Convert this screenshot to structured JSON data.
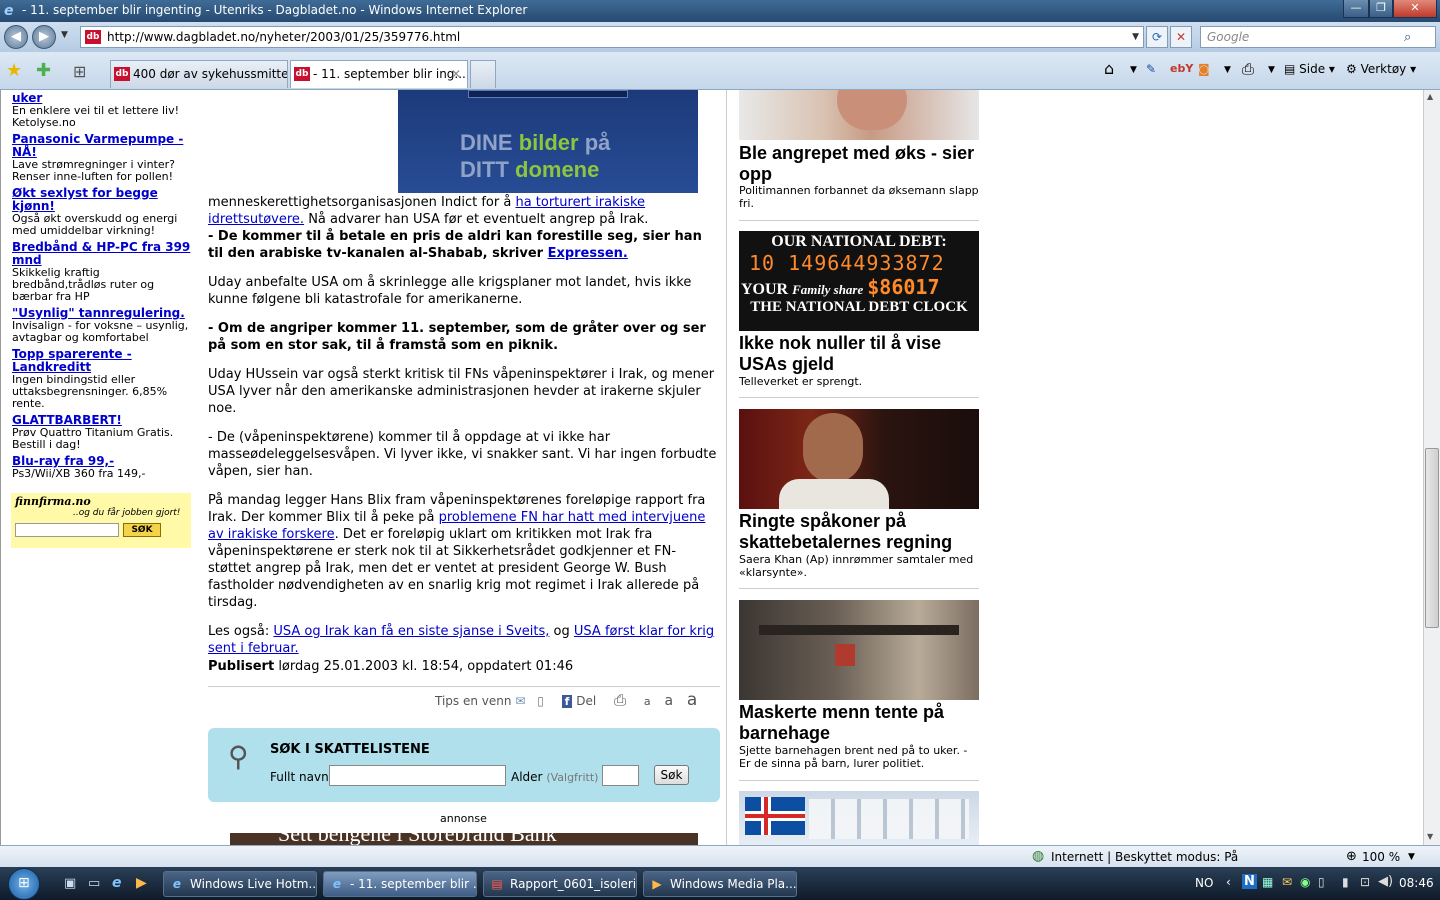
{
  "window": {
    "title": "- 11. september blir ingenting - Utenriks - Dagbladet.no - Windows Internet Explorer",
    "minimize": "—",
    "maximize": "❐",
    "close": "✕"
  },
  "addressbar": {
    "url": "http://www.dagbladet.no/nyheter/2003/01/25/359776.html",
    "search_placeholder": "Google",
    "favicon": "db"
  },
  "tabs": [
    {
      "label": "400 dør av sykehussmitte -..."
    },
    {
      "label": "- 11. september blir ing..."
    }
  ],
  "toolbar": {
    "side_label": "Side",
    "tools_label": "Verktøy"
  },
  "left_ads": [
    {
      "title": "uker",
      "text": "En enklere vei til et lettere liv! Ketolyse.no"
    },
    {
      "title": "Panasonic Varmepumpe - NÅ!",
      "text": "Lave strømregninger i vinter? Renser inne-luften for pollen!"
    },
    {
      "title": "Økt sexlyst for begge kjønn!",
      "text": "Også økt overskudd og energi med umiddelbar virkning!"
    },
    {
      "title": "Bredbånd & HP-PC fra 399 mnd",
      "text": "Skikkelig kraftig bredbånd,trådløs ruter og bærbar fra HP"
    },
    {
      "title": "\"Usynlig\" tannregulering.",
      "text": "Invisalign - for voksne – usynlig, avtagbar og komfortabel"
    },
    {
      "title": "Topp sparerente - Landkreditt",
      "text": "Ingen bindingstid eller uttaksbegrensninger. 6,85% rente."
    },
    {
      "title": "GLATTBARBERT!",
      "text": "Prøv Quattro Titanium Gratis. Bestill i dag!"
    },
    {
      "title": "Blu-ray fra 99,-",
      "text": "Ps3/Wii/XB 360 fra 149,-"
    }
  ],
  "finn": {
    "logo": "finnfirma.no",
    "slogan": "..og du får jobben gjort!",
    "button": "SØK"
  },
  "banner": {
    "line1a": "DINE ",
    "line1b": "bilder",
    "line1c": " på",
    "line2a": "DITT ",
    "line2b": "domene"
  },
  "article": {
    "p1_a": "menneskerettighetsorganisasjonen Indict for å ",
    "p1_link": "ha torturert irakiske idrettsutøvere.",
    "p1_b": " Nå advarer han USA før et eventuelt angrep på Irak.",
    "p1_bold": "- De kommer til å betale en pris de aldri kan forestille seg, sier han til den arabiske tv-kanalen al-Shabab, skriver ",
    "p1_link2": "Expressen.",
    "p2": "Uday anbefalte USA om å skrinlegge alle krigsplaner mot landet, hvis ikke kunne følgene bli katastrofale for amerikanerne.",
    "p3": "- Om de angriper kommer 11. september, som de gråter over og ser på som en stor sak, til å framstå som en piknik.",
    "p4": "Uday HUssein var også sterkt kritisk til FNs våpeninspektører i Irak, og mener USA lyver når den amerikanske administrasjonen hevder at irakerne skjuler noe.",
    "p5": "- De (våpeninspektørene) kommer til å oppdage at vi ikke har masseødeleggelsesvåpen. Vi lyver ikke, vi snakker sant. Vi har ingen forbudte våpen, sier han.",
    "p6_a": "På mandag legger Hans Blix fram våpeninspektørenes foreløpige rapport fra Irak. Der kommer Blix til å peke på ",
    "p6_link": "problemene FN har hatt med intervjuene av irakiske forskere",
    "p6_b": ". Det er foreløpig uklart om kritikken mot Irak fra våpeninspektørene er sterk nok til at Sikkerhetsrådet godkjenner et FN-støttet angrep på Irak, men det er ventet at president George W. Bush fastholder nødvendigheten av en snarlig krig mot regimet i Irak allerede på tirsdag.",
    "p7_a": "Les også: ",
    "p7_link1": "USA og Irak kan få en siste sjanse i Sveits,",
    "p7_b": " og ",
    "p7_link2": "USA først klar for krig sent i februar.",
    "published_label": "Publisert",
    "published_value": " lørdag 25.01.2003 kl. 18:54, oppdatert 01:46"
  },
  "share": {
    "tips": "Tips en venn",
    "del": "Del",
    "a1": "a",
    "a2": "a",
    "a3": "a"
  },
  "taxsearch": {
    "title": "SØK I SKATTELISTENE",
    "name_label": "Fullt navn",
    "age_label": "Alder",
    "age_hint": "(Valgfritt)",
    "button": "Søk"
  },
  "annonse": {
    "label": "annonse",
    "banner": "Sett bengene i Storebrand Bank"
  },
  "right_news": [
    {
      "title": "Ble angrepet med øks - sier opp",
      "sub": "Politimannen forbannet da øksemann slapp fri."
    },
    {
      "title": "Ikke nok nuller til å vise USAs gjeld",
      "sub": "Telleverket er sprengt."
    },
    {
      "title": "Ringte spåkoner på skattebetalernes regning",
      "sub": "Saera Khan (Ap) innrømmer samtaler med «klarsynte»."
    },
    {
      "title": "Maskerte menn tente på barnehage",
      "sub": "Sjette barnehagen brent ned på to uker. - Er de sinna på barn, lurer politiet."
    }
  ],
  "debt": {
    "line1": "OUR NATIONAL DEBT:",
    "digits": "10 149644933872",
    "family_a": "YOUR",
    "family_b": "Family share",
    "family_value": "$86017",
    "line3": "THE NATIONAL DEBT CLOCK"
  },
  "status": {
    "zone": "Internett | Beskyttet modus: På",
    "zoom": "100 %"
  },
  "taskbar": {
    "tasks": [
      {
        "label": "Windows Live Hotm..."
      },
      {
        "label": "- 11. september blir ..."
      },
      {
        "label": "Rapport_0601_isoleri..."
      },
      {
        "label": "Windows Media Pla..."
      }
    ],
    "lang": "NO",
    "clock": "08:46"
  },
  "colors": {
    "link": "#0000cc",
    "titlebar": "#2e557f",
    "taxbox": "#b0e0ec",
    "finn": "#fff9a8"
  }
}
